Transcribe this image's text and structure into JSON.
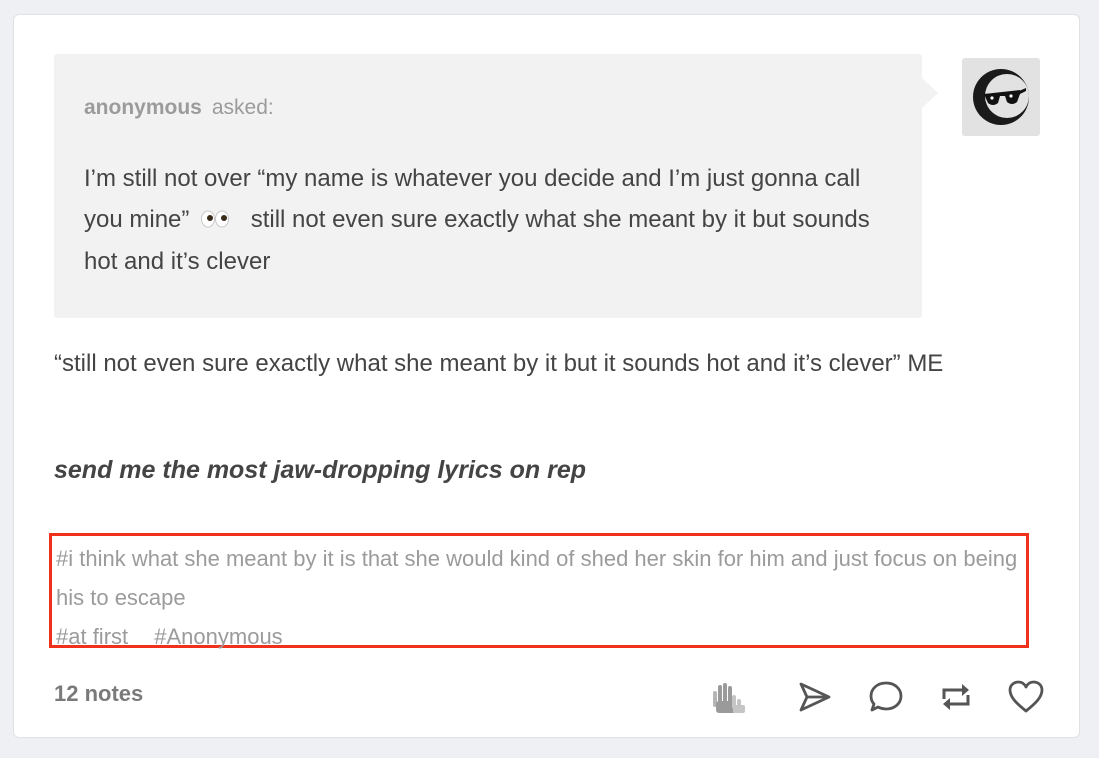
{
  "ask": {
    "asker": "anonymous",
    "asked_label": "asked:",
    "question_part1": "I’m still not over “my name is whatever you decide and I’m just gonna call you mine”",
    "question_emoji": "👀",
    "question_part2": "still not even sure exactly what she meant by it but sounds hot and it’s clever"
  },
  "avatar": {
    "icon": "sunglasses-moon-avatar-icon"
  },
  "answer": {
    "text": "“still not even sure exactly what she meant by it but it sounds hot and it’s clever” ME",
    "cta": "send me the most jaw-dropping lyrics on rep"
  },
  "tags": {
    "tag1": "#i think what she meant by it is that she would kind of shed her skin for him and just focus on being his to escape",
    "tag2": "#at first",
    "tag3": "#Anonymous"
  },
  "footer": {
    "notes": "12 notes",
    "icons": [
      "clapping-hands-icon",
      "share-icon",
      "reply-icon",
      "reblog-icon",
      "heart-icon"
    ]
  },
  "colors": {
    "highlight_border": "#f0321d",
    "ask_background": "#f2f2f2",
    "icon_gray": "#555555"
  }
}
